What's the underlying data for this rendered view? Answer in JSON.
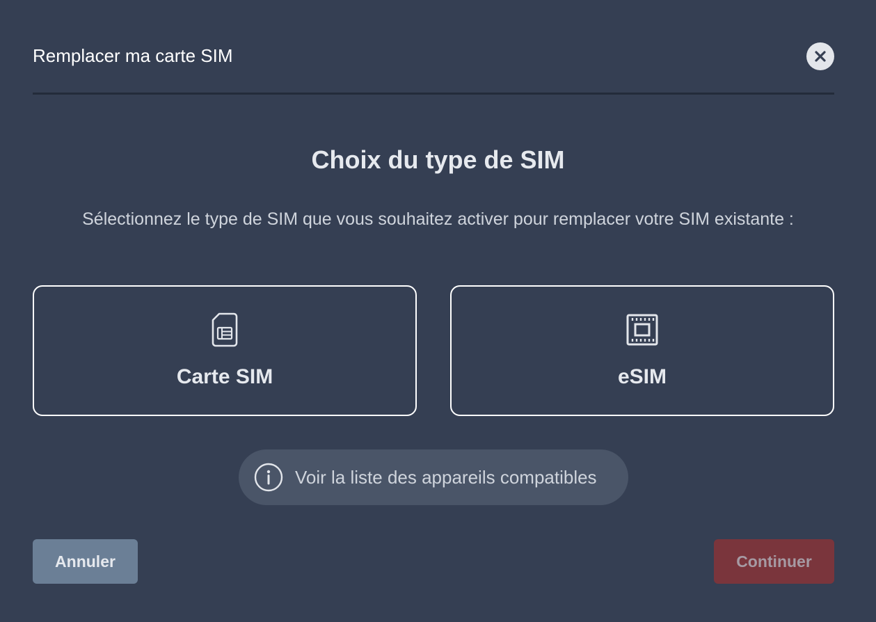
{
  "modal": {
    "title": "Remplacer ma carte SIM",
    "close_icon": "close-icon"
  },
  "content": {
    "heading": "Choix du type de SIM",
    "description": "Sélectionnez le type de SIM que vous souhaitez activer pour remplacer votre SIM existante :"
  },
  "options": [
    {
      "label": "Carte SIM",
      "icon": "sim-card-icon"
    },
    {
      "label": "eSIM",
      "icon": "esim-chip-icon"
    }
  ],
  "compatible_link": {
    "label": "Voir la liste des appareils compatibles",
    "icon": "info-icon"
  },
  "footer": {
    "cancel_label": "Annuler",
    "continue_label": "Continuer"
  },
  "colors": {
    "background": "#353f53",
    "card_border": "#ffffff",
    "cancel_button": "#6b7f96",
    "continue_button_disabled": "#7a353c",
    "pill_background": "#4a5568"
  }
}
